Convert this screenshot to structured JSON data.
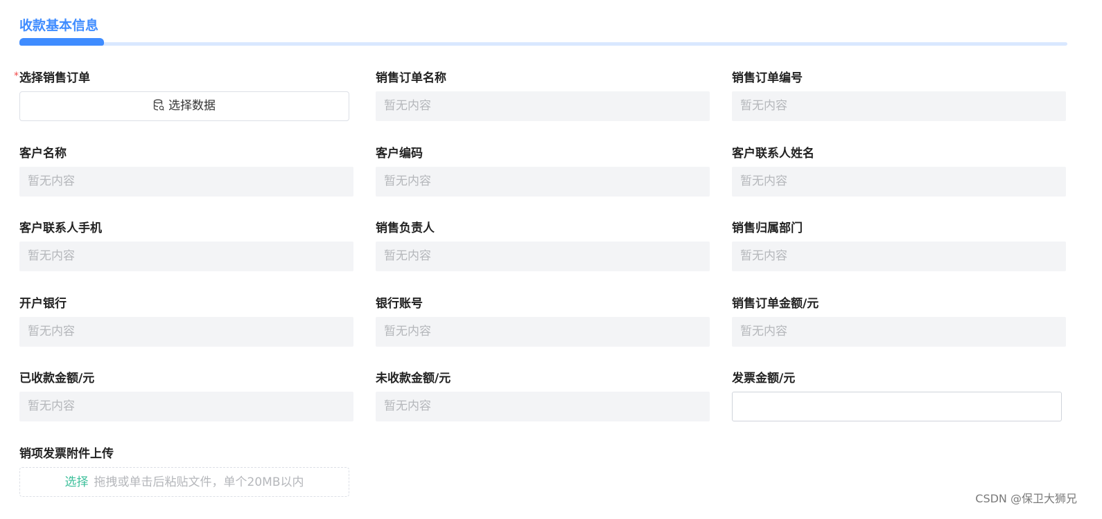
{
  "section": {
    "title": "收款基本信息"
  },
  "order_select": {
    "label": "选择销售订单",
    "required_mark": "*",
    "button_label": "选择数据",
    "icon": "database-icon"
  },
  "fields": {
    "sales_order_name": {
      "label": "销售订单名称",
      "placeholder": "暂无内容"
    },
    "sales_order_no": {
      "label": "销售订单编号",
      "placeholder": "暂无内容"
    },
    "customer_name": {
      "label": "客户名称",
      "placeholder": "暂无内容"
    },
    "customer_code": {
      "label": "客户编码",
      "placeholder": "暂无内容"
    },
    "contact_name": {
      "label": "客户联系人姓名",
      "placeholder": "暂无内容"
    },
    "contact_phone": {
      "label": "客户联系人手机",
      "placeholder": "暂无内容"
    },
    "sales_owner": {
      "label": "销售负责人",
      "placeholder": "暂无内容"
    },
    "sales_dept": {
      "label": "销售归属部门",
      "placeholder": "暂无内容"
    },
    "bank_name": {
      "label": "开户银行",
      "placeholder": "暂无内容"
    },
    "bank_account": {
      "label": "银行账号",
      "placeholder": "暂无内容"
    },
    "order_amount": {
      "label": "销售订单金额/元",
      "placeholder": "暂无内容"
    },
    "received_amount": {
      "label": "已收款金额/元",
      "placeholder": "暂无内容"
    },
    "unreceived_amount": {
      "label": "未收款金额/元",
      "placeholder": "暂无内容"
    }
  },
  "invoice_amount": {
    "label": "发票金额/元",
    "value": ""
  },
  "upload": {
    "label": "销项发票附件上传",
    "link_text": "选择",
    "hint": "拖拽或单击后粘贴文件，单个20MB以内"
  },
  "watermark": "CSDN @保卫大狮兄",
  "colors": {
    "accent": "#3f8cff",
    "tab_track": "#d9e8ff",
    "required": "#f04a4a",
    "upload_link": "#3cbf9a",
    "readonly_bg": "#f3f4f6",
    "placeholder": "#b5b7bb"
  }
}
